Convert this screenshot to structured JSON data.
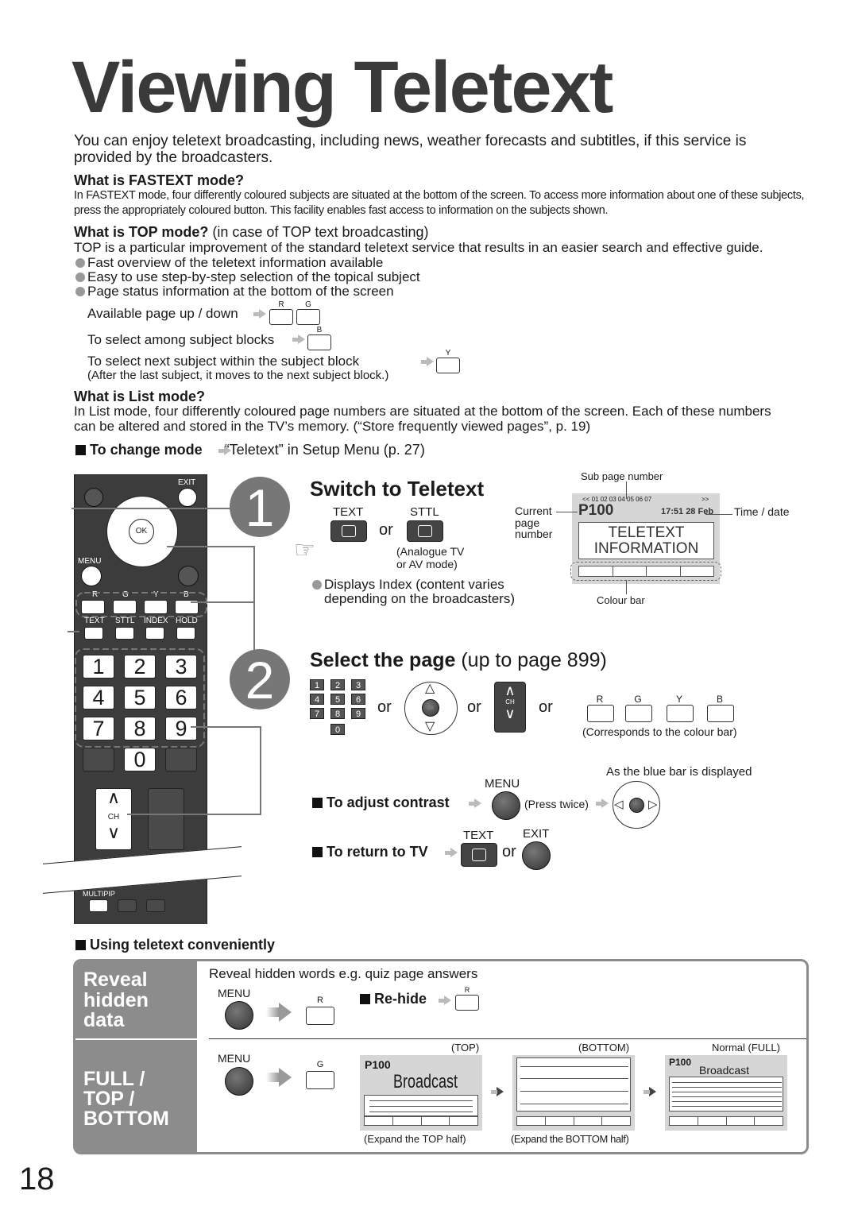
{
  "title": "Viewing Teletext",
  "intro": "You can enjoy teletext broadcasting, including news, weather forecasts and subtitles, if this service is provided by the broadcasters.",
  "fastext": {
    "heading": "What is FASTEXT mode?",
    "body": "In FASTEXT mode, four differently coloured subjects are situated at the bottom of the screen. To access more information about one of these subjects, press the appropriately coloured button. This facility enables fast access to information on the subjects shown."
  },
  "top": {
    "heading": "What is TOP mode?",
    "heading_note": " (in case of TOP text broadcasting)",
    "body": "TOP is a particular improvement of the standard teletext service that results in an easier search and effective guide.",
    "bullets": [
      "Fast overview of the teletext information available",
      "Easy to use step-by-step selection of the topical subject",
      "Page status information at the bottom of the screen"
    ],
    "page_updown": "Available page up / down",
    "subject_blocks": "To select among subject blocks",
    "next_subject": "To select next subject within the subject block",
    "after_last": "(After the last subject, it moves to the next subject block.)"
  },
  "keys": {
    "r": "R",
    "g": "G",
    "y": "Y",
    "b": "B"
  },
  "list": {
    "heading": "What is List mode?",
    "body": "In List mode, four differently coloured page numbers are situated at the bottom of the screen. Each of these numbers can be altered and stored in the TV’s memory. (“Store frequently viewed pages”, p. 19)"
  },
  "change_mode": {
    "label": "To change mode",
    "value": "“Teletext” in Setup Menu (p. 27)"
  },
  "remote": {
    "exit": "EXIT",
    "ok": "OK",
    "menu": "MENU",
    "text": "TEXT",
    "sttl": "STTL",
    "index": "INDEX",
    "hold": "HOLD",
    "numbers": [
      "1",
      "2",
      "3",
      "4",
      "5",
      "6",
      "7",
      "8",
      "9",
      "0"
    ],
    "ch": "CH",
    "multipip": "MULTIPIP"
  },
  "step1": {
    "number": "1",
    "title": "Switch to Teletext",
    "text_label": "TEXT",
    "sttl_label": "STTL",
    "or": "or",
    "analogue": "(Analogue TV",
    "analogue2": "or AV mode)",
    "note1": "Displays Index (content varies",
    "note2": "depending on the broadcasters)"
  },
  "screen": {
    "sub_page_label": "Sub page number",
    "subpages": "<< 01 02 03 04 05 06 07",
    "next": ">>",
    "current_label1": "Current",
    "current_label2": "page",
    "current_label3": "number",
    "page": "P100",
    "time": "17:51 28 Feb",
    "time_label": "Time / date",
    "line1": "TELETEXT",
    "line2": "INFORMATION",
    "colour_bar_label": "Colour bar"
  },
  "step2": {
    "number": "2",
    "title": "Select the page",
    "title_note": " (up to page 899)",
    "or": "or",
    "ch": "CH",
    "ok": "OK",
    "corresponds": "(Corresponds to the colour bar)"
  },
  "contrast": {
    "label": "To adjust contrast",
    "menu": "MENU",
    "press_twice": "(Press twice)",
    "blue_bar": "As the blue bar is displayed"
  },
  "return_tv": {
    "label": "To return to TV",
    "text": "TEXT",
    "exit": "EXIT",
    "or": "or"
  },
  "convenient": {
    "heading": "Using teletext conveniently",
    "reveal": {
      "title": [
        "Reveal",
        "hidden",
        "data"
      ],
      "desc": "Reveal hidden words e.g. quiz page answers",
      "menu": "MENU",
      "rehide": "Re-hide"
    },
    "full": {
      "title": [
        "FULL /",
        "TOP /",
        "BOTTOM"
      ],
      "menu": "MENU",
      "top_label": "(TOP)",
      "bottom_label": "(BOTTOM)",
      "normal_label": "Normal (FULL)",
      "page": "P100",
      "broadcast": "Broadcast",
      "expand_top": "(Expand the TOP half)",
      "expand_bottom": "(Expand the BOTTOM half)"
    }
  },
  "page_number": "18",
  "colors": {
    "title": "#3a3a3a",
    "remote": "#3c3c3c",
    "step_circle": "#777777",
    "panel_label": "#8c8c8c",
    "screen_bg": "#d6d6d6"
  }
}
